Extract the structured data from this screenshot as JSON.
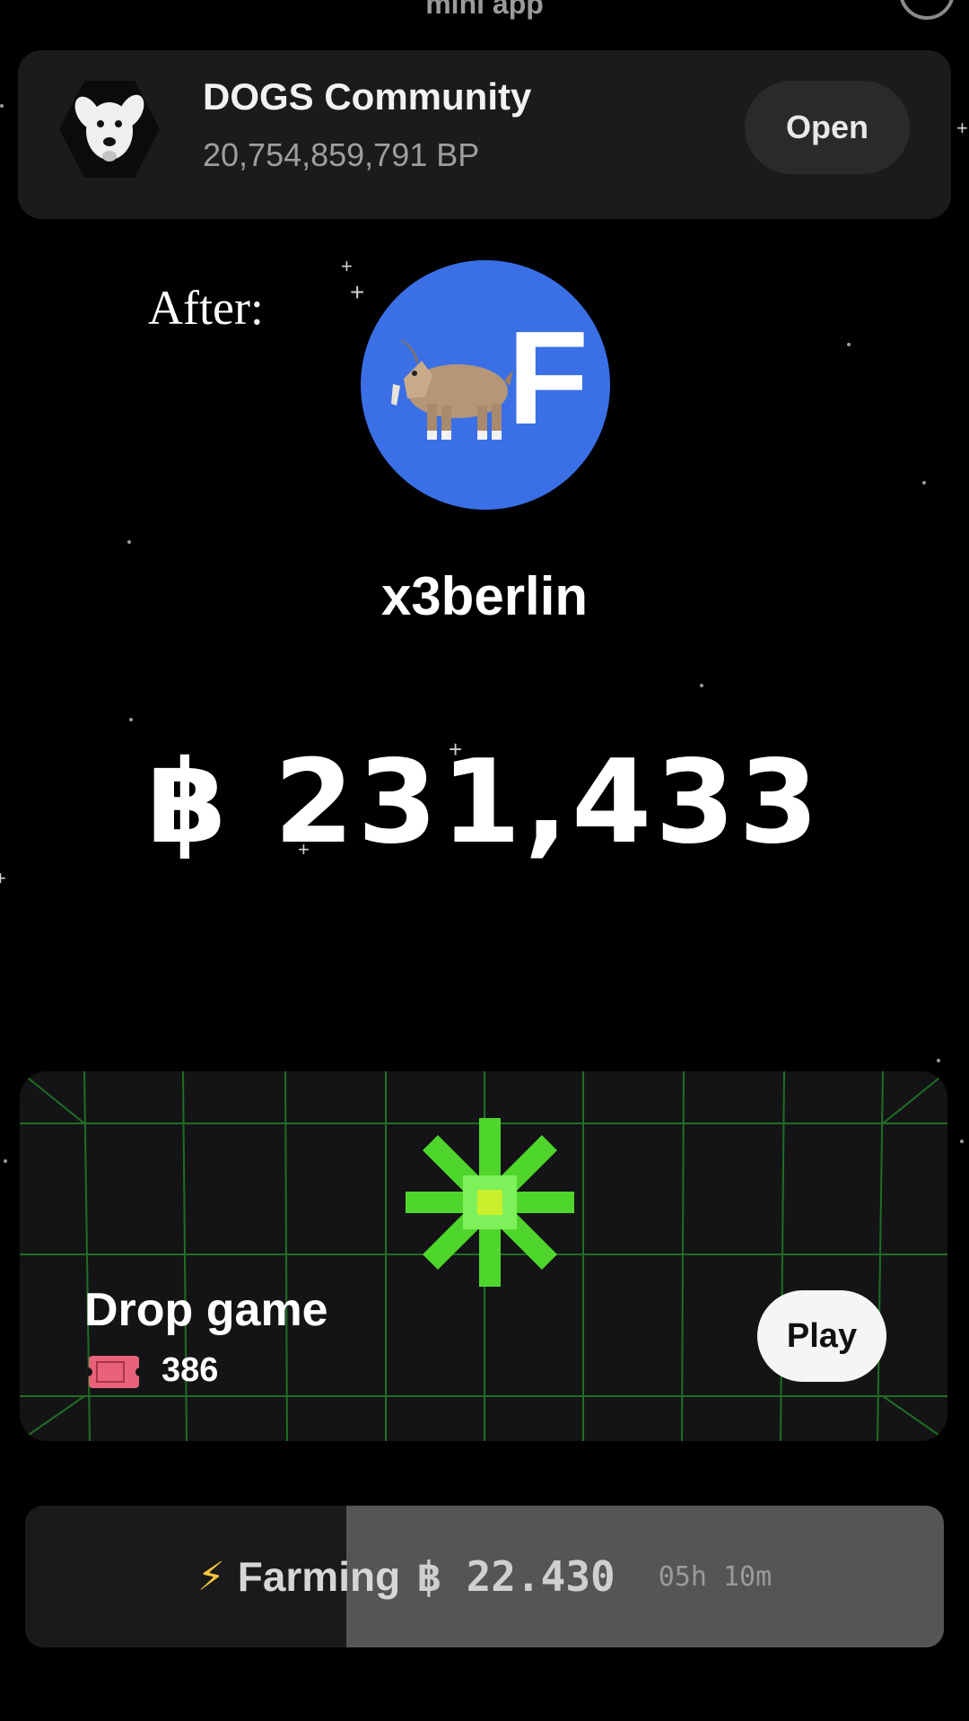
{
  "topbar": {
    "title": "mini app"
  },
  "community": {
    "name": "DOGS Community",
    "bp": "20,754,859,791 BP",
    "open_label": "Open"
  },
  "overlay_label": "After:",
  "profile": {
    "avatar_letter": "F",
    "avatar_color": "#3a6fe6",
    "avatar_emoji": "goat",
    "username": "x3berlin"
  },
  "balance": {
    "value": "฿ 231,433"
  },
  "drop_game": {
    "title": "Drop game",
    "tickets": "386",
    "play_label": "Play"
  },
  "farming": {
    "label": "Farming",
    "amount": "฿ 22.430",
    "timer": "05h 10m",
    "progress_percent": 65
  }
}
